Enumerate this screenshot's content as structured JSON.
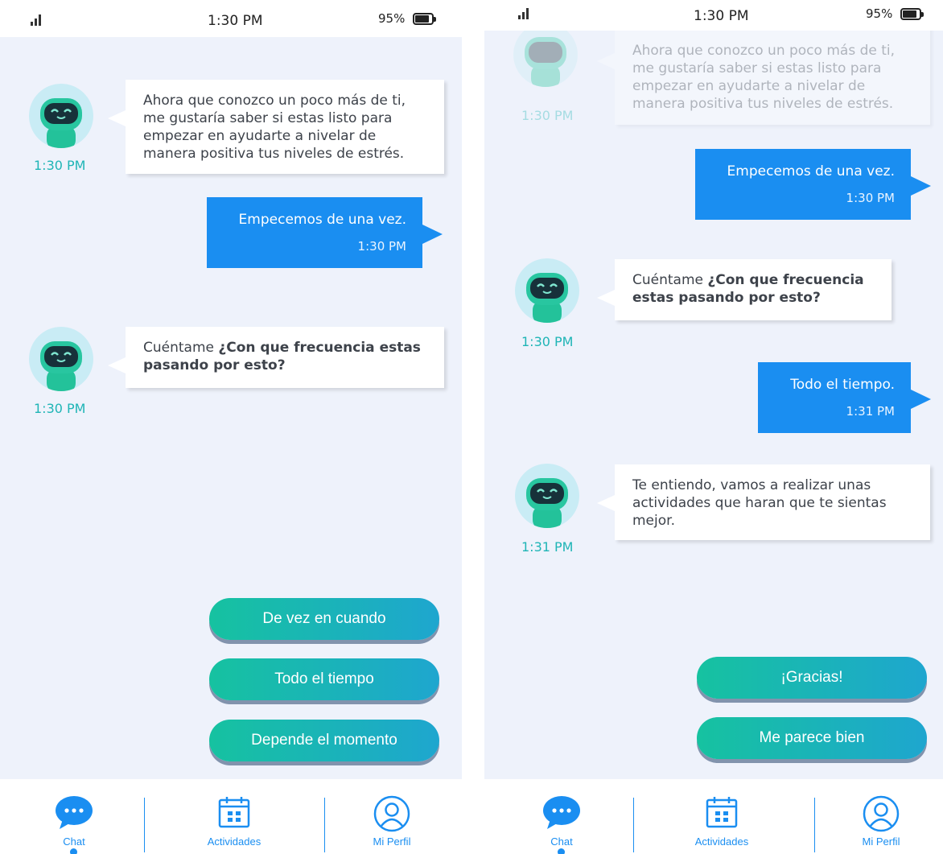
{
  "status": {
    "time": "1:30 PM",
    "battery": "95%"
  },
  "left": {
    "messages": {
      "bot1": {
        "text": "Ahora que conozco un poco más de ti, me gustaría saber si estas listo para empezar en ayudarte a nivelar de manera positiva tus niveles de estrés.",
        "time": "1:30 PM"
      },
      "user1": {
        "text": "Empecemos de una vez.",
        "time": "1:30 PM"
      },
      "bot2": {
        "prefix": "Cuéntame ",
        "bold": "¿Con que frecuencia estas pasando por esto?",
        "time": "1:30 PM"
      }
    },
    "replies": [
      "De vez en cuando",
      "Todo el tiempo",
      "Depende el momento"
    ]
  },
  "right": {
    "messages": {
      "bot1": {
        "text": "Ahora que conozco un poco más de ti, me gustaría saber si estas listo para empezar en ayudarte a nivelar de manera positiva tus niveles de estrés.",
        "time": "1:30 PM"
      },
      "user1": {
        "text": "Empecemos de una vez.",
        "time": "1:30 PM"
      },
      "bot2": {
        "prefix": "Cuéntame ",
        "bold": "¿Con que frecuencia estas pasando por esto?",
        "time": "1:30 PM"
      },
      "user2": {
        "text": "Todo el tiempo.",
        "time": "1:31 PM"
      },
      "bot3": {
        "text": "Te entiendo, vamos a realizar unas actividades que haran que te sientas mejor.",
        "time": "1:31 PM"
      }
    },
    "replies": [
      "¡Gracias!",
      "Me parece bien"
    ]
  },
  "tabs": {
    "chat": "Chat",
    "activities": "Actividades",
    "profile": "Mi Perfil"
  },
  "colors": {
    "accent": "#1a8ef1",
    "teal": "#1fb5b6",
    "chat_bg": "#eef2fb",
    "gradient_start": "#16c2a0",
    "gradient_end": "#1ea6cf"
  },
  "icons": {
    "chat": "chat-bubble-icon",
    "activities": "calendar-icon",
    "profile": "user-circle-icon",
    "bot": "robot-avatar"
  }
}
